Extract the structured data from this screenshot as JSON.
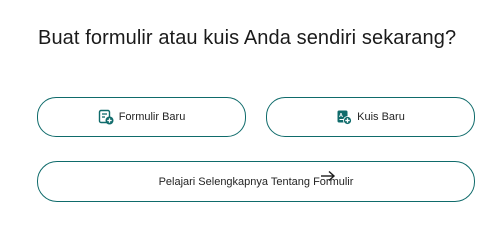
{
  "heading": "Buat formulir atau kuis Anda sendiri sekarang?",
  "buttons": {
    "new_form": "Formulir Baru",
    "new_quiz": "Kuis Baru",
    "learn_more": "Pelajari Selengkapnya Tentang Formulir"
  },
  "icons": {
    "new_form": "form-add-icon",
    "new_quiz": "quiz-add-icon",
    "learn_more": "arrow-right-icon"
  },
  "colors": {
    "accent": "#0f6b6b",
    "border": "#0f6b6b",
    "text": "#242424"
  }
}
